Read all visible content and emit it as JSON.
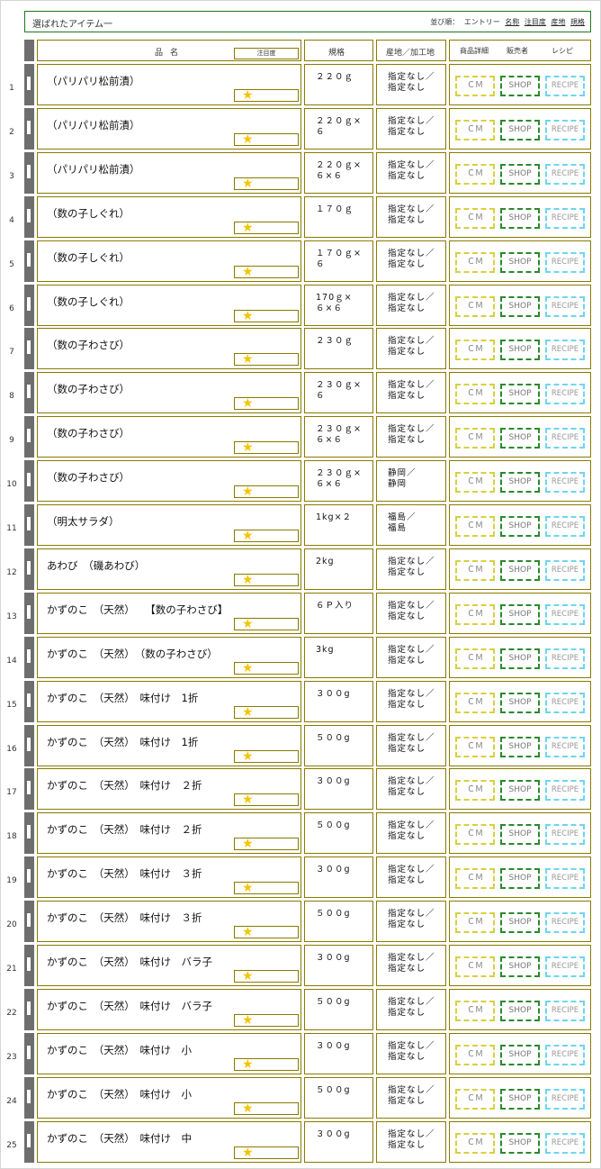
{
  "header": {
    "title": "選ばれたアイテム一",
    "sort_label": "並び順：",
    "sort_entry": "エントリー",
    "sort_links": [
      "名称",
      "注目度",
      "産地",
      "規格"
    ]
  },
  "columns": {
    "name": "品名",
    "attention": "注目度",
    "spec": "規格",
    "origin": "産地／加工地",
    "details": "商品詳細",
    "seller": "販売者",
    "recipe": "レシピ"
  },
  "buttons": {
    "cm": "ＣＭ",
    "shop": "SHOP",
    "recipe": "RECIPE"
  },
  "star_glyph": "★",
  "colors": {
    "frame": "#1e7a1e",
    "cell_border": "#8a7a00",
    "bar": "#6e6e6e",
    "star": "#f2c500",
    "cm_border": "#d8d040",
    "shop_border": "#2a8a2a",
    "recipe_border": "#6ed6ee"
  },
  "rows": [
    {
      "num": "1",
      "name": "（パリパリ松前漬）",
      "spec": "２２０ｇ",
      "origin": "指定なし／\n指定なし"
    },
    {
      "num": "2",
      "name": "（パリパリ松前漬）",
      "spec": "２２０ｇ×\n６",
      "origin": "指定なし／\n指定なし"
    },
    {
      "num": "3",
      "name": "（パリパリ松前漬）",
      "spec": "２２０ｇ×\n６×６",
      "origin": "指定なし／\n指定なし"
    },
    {
      "num": "4",
      "name": "（数の子しぐれ）",
      "spec": "１７０ｇ",
      "origin": "指定なし／\n指定なし"
    },
    {
      "num": "5",
      "name": "（数の子しぐれ）",
      "spec": "１７０ｇ×\n６",
      "origin": "指定なし／\n指定なし"
    },
    {
      "num": "6",
      "name": "（数の子しぐれ）",
      "spec": "170ｇ×\n６×６",
      "origin": "指定なし／\n指定なし"
    },
    {
      "num": "7",
      "name": "（数の子わさび）",
      "spec": "２３０ｇ",
      "origin": "指定なし／\n指定なし"
    },
    {
      "num": "8",
      "name": "（数の子わさび）",
      "spec": "２３０ｇ×\n６",
      "origin": "指定なし／\n指定なし"
    },
    {
      "num": "9",
      "name": "（数の子わさび）",
      "spec": "２３０ｇ×\n６×６",
      "origin": "指定なし／\n指定なし"
    },
    {
      "num": "10",
      "name": "（数の子わさび）",
      "spec": "２３０ｇ×\n６×６",
      "origin": "静岡／\n静岡"
    },
    {
      "num": "11",
      "name": "（明太サラダ）",
      "spec": "1kg×２",
      "origin": "福島／\n福島"
    },
    {
      "num": "12",
      "name": "あわび　（磯あわび）",
      "spec": "2kg",
      "origin": "指定なし／\n指定なし"
    },
    {
      "num": "13",
      "name": "かずのこ　（天然）　　【数の子わさび】",
      "spec": "６Ｐ入り",
      "origin": "指定なし／\n指定なし"
    },
    {
      "num": "14",
      "name": "かずのこ　（天然）　（数の子わさび）",
      "spec": "3kg",
      "origin": "指定なし／\n指定なし"
    },
    {
      "num": "15",
      "name": "かずのこ　（天然）　味付け　1折",
      "spec": "３００g",
      "origin": "指定なし／\n指定なし"
    },
    {
      "num": "16",
      "name": "かずのこ　（天然）　味付け　1折",
      "spec": "５００g",
      "origin": "指定なし／\n指定なし"
    },
    {
      "num": "17",
      "name": "かずのこ　（天然）　味付け　２折",
      "spec": "３００g",
      "origin": "指定なし／\n指定なし"
    },
    {
      "num": "18",
      "name": "かずのこ　（天然）　味付け　２折",
      "spec": "５００g",
      "origin": "指定なし／\n指定なし"
    },
    {
      "num": "19",
      "name": "かずのこ　（天然）　味付け　３折",
      "spec": "３００g",
      "origin": "指定なし／\n指定なし"
    },
    {
      "num": "20",
      "name": "かずのこ　（天然）　味付け　３折",
      "spec": "５００g",
      "origin": "指定なし／\n指定なし"
    },
    {
      "num": "21",
      "name": "かずのこ　（天然）　味付け　バラ子",
      "spec": "３００g",
      "origin": "指定なし／\n指定なし"
    },
    {
      "num": "22",
      "name": "かずのこ　（天然）　味付け　バラ子",
      "spec": "５００g",
      "origin": "指定なし／\n指定なし"
    },
    {
      "num": "23",
      "name": "かずのこ　（天然）　味付け　小",
      "spec": "３００g",
      "origin": "指定なし／\n指定なし"
    },
    {
      "num": "24",
      "name": "かずのこ　（天然）　味付け　小",
      "spec": "５００g",
      "origin": "指定なし／\n指定なし"
    },
    {
      "num": "25",
      "name": "かずのこ　（天然）　味付け　中",
      "spec": "３００g",
      "origin": "指定なし／\n指定なし"
    }
  ]
}
